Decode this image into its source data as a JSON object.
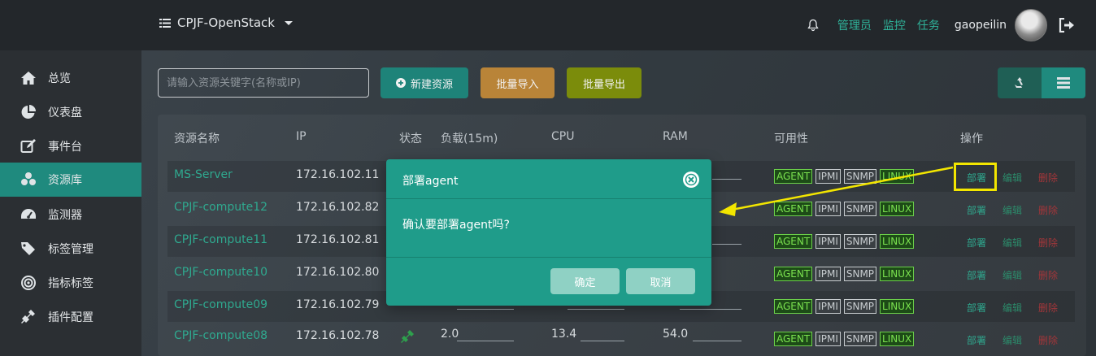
{
  "topbar": {
    "project": "CPJF-OpenStack",
    "links": [
      "管理员",
      "监控",
      "任务"
    ],
    "username": "gaopeilin"
  },
  "sidebar": {
    "items": [
      {
        "label": "总览",
        "icon": "home-icon"
      },
      {
        "label": "仪表盘",
        "icon": "pie-chart-icon"
      },
      {
        "label": "事件台",
        "icon": "edit-icon"
      },
      {
        "label": "资源库",
        "icon": "cubes-icon",
        "active": true
      },
      {
        "label": "监测器",
        "icon": "dashboard-icon"
      },
      {
        "label": "标签管理",
        "icon": "tags-icon"
      },
      {
        "label": "指标标签",
        "icon": "target-icon"
      },
      {
        "label": "插件配置",
        "icon": "plug-icon"
      }
    ]
  },
  "toolbar": {
    "search_placeholder": "请输入资源关键字(名称或IP)",
    "new_label": "新建资源",
    "import_label": "批量导入",
    "export_label": "批量导出"
  },
  "table": {
    "headers": {
      "name": "资源名称",
      "ip": "IP",
      "status": "状态",
      "load": "负载(15m)",
      "cpu": "CPU",
      "ram": "RAM",
      "availability": "可用性",
      "ops": "操作"
    },
    "badges": [
      "AGENT",
      "IPMI",
      "SNMP",
      "LINUX"
    ],
    "actions": {
      "deploy": "部署",
      "edit": "编辑",
      "delete": "删除"
    },
    "rows": [
      {
        "name": "MS-Server",
        "ip": "172.16.102.11"
      },
      {
        "name": "CPJF-compute12",
        "ip": "172.16.102.82"
      },
      {
        "name": "CPJF-compute11",
        "ip": "172.16.102.81"
      },
      {
        "name": "CPJF-compute10",
        "ip": "172.16.102.80"
      },
      {
        "name": "CPJF-compute09",
        "ip": "172.16.102.79"
      },
      {
        "name": "CPJF-compute08",
        "ip": "172.16.102.78",
        "load": "2.0",
        "cpu": "13.4",
        "ram": "54.0"
      }
    ]
  },
  "modal": {
    "title": "部署agent",
    "message": "确认要部署agent吗?",
    "confirm": "确定",
    "cancel": "取消"
  },
  "colors": {
    "accent": "#1f8a7e",
    "modal": "#1f9c8a",
    "highlight": "#f3e600"
  }
}
